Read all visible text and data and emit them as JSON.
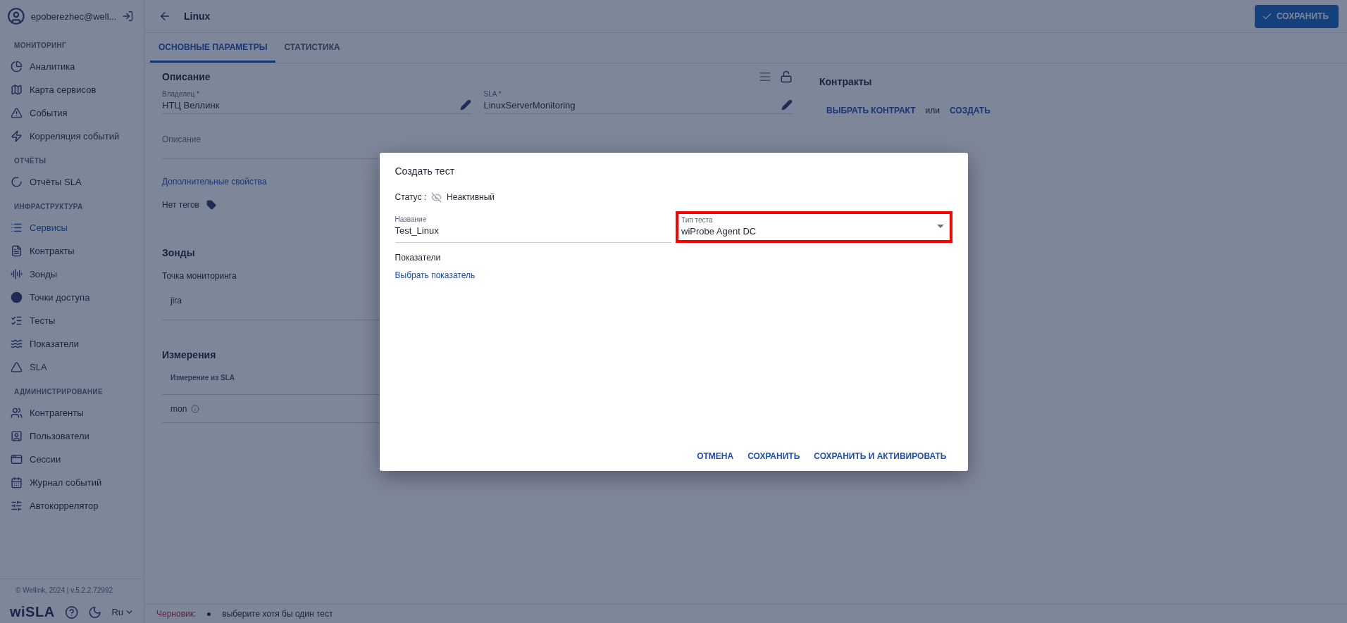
{
  "user": {
    "email": "epoberezhec@well..."
  },
  "sidebar": {
    "sections": [
      {
        "title": "МОНИТОРИНГ",
        "items": [
          {
            "label": "Аналитика",
            "selected": false
          },
          {
            "label": "Карта сервисов",
            "selected": false
          },
          {
            "label": "События",
            "selected": false
          },
          {
            "label": "Корреляция событий",
            "selected": false
          }
        ]
      },
      {
        "title": "ОТЧЁТЫ",
        "items": [
          {
            "label": "Отчёты SLA",
            "selected": false
          }
        ]
      },
      {
        "title": "ИНФРАСТРУКТУРА",
        "items": [
          {
            "label": "Сервисы",
            "selected": true
          },
          {
            "label": "Контракты",
            "selected": false
          },
          {
            "label": "Зонды",
            "selected": false
          },
          {
            "label": "Точки доступа",
            "selected": false
          },
          {
            "label": "Тесты",
            "selected": false
          },
          {
            "label": "Показатели",
            "selected": false
          },
          {
            "label": "SLA",
            "selected": false
          }
        ]
      },
      {
        "title": "АДМИНИСТРИРОВАНИЕ",
        "items": [
          {
            "label": "Контрагенты",
            "selected": false
          },
          {
            "label": "Пользователи",
            "selected": false
          },
          {
            "label": "Сессии",
            "selected": false
          },
          {
            "label": "Журнал событий",
            "selected": false
          },
          {
            "label": "Автокоррелятор",
            "selected": false
          }
        ]
      }
    ]
  },
  "footer": {
    "copyright": "© Wellink, 2024 | v.5.2.2.72992",
    "logo": "wiSLA",
    "language": "Ru"
  },
  "header": {
    "title": "Linux",
    "save_button": "СОХРАНИТЬ"
  },
  "tabs": [
    {
      "label": "ОСНОВНЫЕ ПАРАМЕТРЫ",
      "selected": true
    },
    {
      "label": "СТАТИСТИКА",
      "selected": false
    }
  ],
  "description": {
    "heading": "Описание",
    "fields": [
      {
        "label": "Владелец *",
        "value": "НТЦ Веллинк"
      },
      {
        "label": "SLA *",
        "value": "LinuxServerMonitoring"
      }
    ],
    "description_placeholder": "Описание",
    "extra_link": "Дополнительные свойства",
    "tags_label": "Нет тегов"
  },
  "probes": {
    "heading": "Зонды",
    "label": "Точка мониторинга",
    "items": [
      "jira"
    ]
  },
  "measurements": {
    "heading": "Измерения",
    "column_1": "Измерение из SLA",
    "rows": [
      "mon"
    ]
  },
  "contracts": {
    "heading": "Контракты",
    "choose": "ВЫБРАТЬ КОНТРАКТ",
    "or": "или",
    "create": "СОЗДАТЬ"
  },
  "status_bar": {
    "label": "Черновик:",
    "messages": [
      "выберите хотя бы один тест"
    ]
  },
  "dialog": {
    "title": "Создать тест",
    "status_label": "Статус :",
    "status": "Неактивный",
    "fields": [
      {
        "kind": "text",
        "label": "Название",
        "value": "Test_Linux",
        "highlighted": false
      },
      {
        "kind": "select",
        "label": "Тип теста",
        "value": "wiProbe Agent DC",
        "highlighted": true
      }
    ],
    "metrics_label": "Показатели",
    "metrics_link": "Выбрать показатель",
    "buttons": [
      "ОТМЕНА",
      "СОХРАНИТЬ",
      "СОХРАНИТЬ И АКТИВИРОВАТЬ"
    ]
  }
}
